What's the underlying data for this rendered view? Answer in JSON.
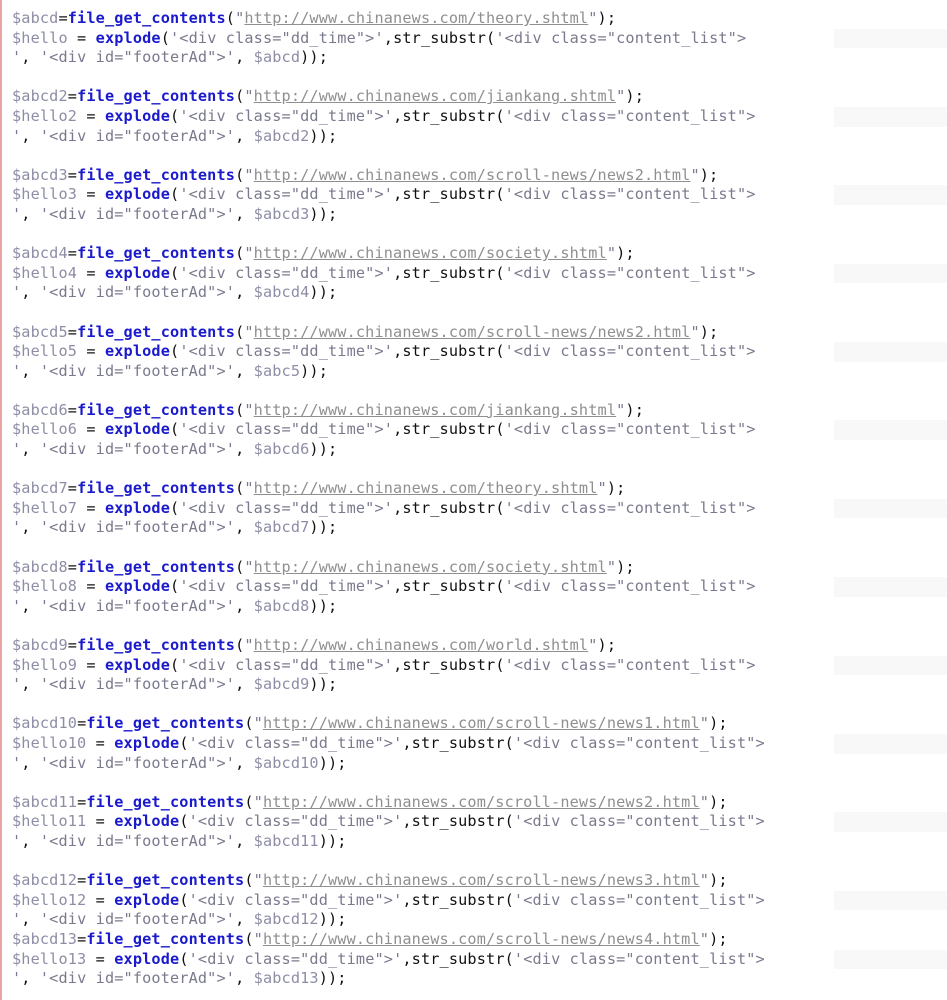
{
  "blocks": [
    {
      "var_a": "$abcd",
      "var_b": "$hello",
      "url": "http://www.chinanews.com/theory.shtml",
      "arg": "$abcd"
    },
    {
      "var_a": "$abcd2",
      "var_b": "$hello2",
      "url": "http://www.chinanews.com/jiankang.shtml",
      "arg": "$abcd2"
    },
    {
      "var_a": "$abcd3",
      "var_b": "$hello3",
      "url": "http://www.chinanews.com/scroll-news/news2.html",
      "arg": "$abcd3"
    },
    {
      "var_a": "$abcd4",
      "var_b": "$hello4",
      "url": "http://www.chinanews.com/society.shtml",
      "arg": "$abcd4"
    },
    {
      "var_a": "$abcd5",
      "var_b": "$hello5",
      "url": "http://www.chinanews.com/scroll-news/news2.html",
      "arg": "$abc5"
    },
    {
      "var_a": "$abcd6",
      "var_b": "$hello6",
      "url": "http://www.chinanews.com/jiankang.shtml",
      "arg": "$abcd6"
    },
    {
      "var_a": "$abcd7",
      "var_b": "$hello7",
      "url": "http://www.chinanews.com/theory.shtml",
      "arg": "$abcd7"
    },
    {
      "var_a": "$abcd8",
      "var_b": "$hello8",
      "url": "http://www.chinanews.com/society.shtml",
      "arg": "$abcd8"
    },
    {
      "var_a": "$abcd9",
      "var_b": "$hello9",
      "url": "http://www.chinanews.com/world.shtml",
      "arg": "$abcd9"
    },
    {
      "var_a": "$abcd10",
      "var_b": "$hello10",
      "url": "http://www.chinanews.com/scroll-news/news1.html",
      "arg": "$abcd10"
    },
    {
      "var_a": "$abcd11",
      "var_b": "$hello11",
      "url": "http://www.chinanews.com/scroll-news/news2.html",
      "arg": "$abcd11"
    },
    {
      "var_a": "$abcd12",
      "var_b": "$hello12",
      "url": "http://www.chinanews.com/scroll-news/news3.html",
      "arg": "$abcd12"
    },
    {
      "var_a": "$abcd13",
      "var_b": "$hello13",
      "url": "http://www.chinanews.com/scroll-news/news4.html",
      "arg": "$abcd13"
    }
  ],
  "syntax": {
    "fn_get": "file_get_contents",
    "fn_explode": "explode",
    "fn_substr": "str_substr",
    "assign": "=",
    "assign_spaced": " = ",
    "open_paren": "(",
    "close_stmt": ");",
    "close_stmt2": "));",
    "quote": "\"",
    "comma": ",",
    "split_string": "'<div class=\"dd_time\">'",
    "content_string_open": "'<div class=\"content_list\">",
    "content_string_close": "'",
    "footer_string": "'<div id=\"footerAd\">'",
    "sep": ", "
  },
  "colors": {
    "variable": "#8d8da6",
    "function": "#1a1acc",
    "string": "#7a7a8e",
    "punctuation": "#111111",
    "url": "#8f8f8f",
    "gutter_border": "#e7a5a5"
  }
}
